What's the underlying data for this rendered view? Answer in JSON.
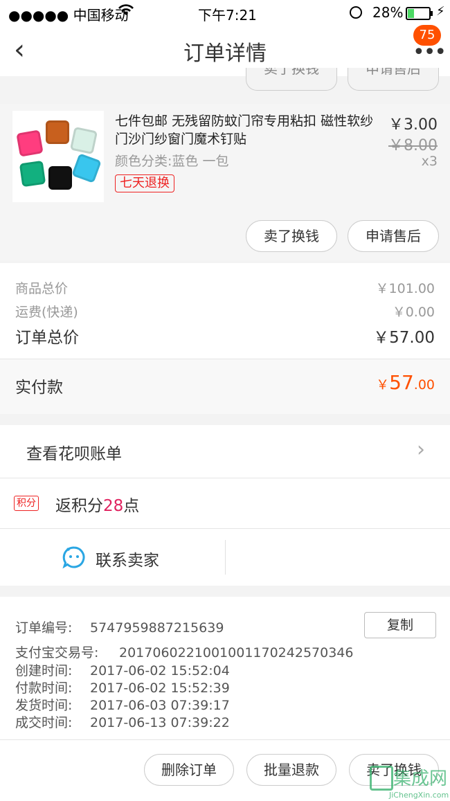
{
  "status_bar": {
    "carrier": "●●●●● 中国移动",
    "time": "下午7:21",
    "battery": "28%"
  },
  "nav": {
    "title": "订单详情",
    "badge": "75"
  },
  "partial_buttons": [
    "卖了换钱",
    "申请售后"
  ],
  "product": {
    "name": "七件包邮 无残留防蚊门帘专用粘扣 磁性软纱门沙门纱窗门魔术钉贴",
    "attributes": "颜色分类:蓝色 一包",
    "tag": "七天退换",
    "price": "￥3.00",
    "original_price": "￥8.00",
    "quantity": "x3",
    "buttons": [
      "卖了换钱",
      "申请售后"
    ],
    "cube_colors": [
      "#ff3d7f",
      "#c8601e",
      "#d9f0e6",
      "#12b07f",
      "#111111",
      "#39c6ee"
    ]
  },
  "summary": {
    "goods_total_label": "商品总价",
    "goods_total_value": "￥101.00",
    "shipping_label": "运费(快递)",
    "shipping_value": "￥0.00",
    "order_total_label": "订单总价",
    "order_total_value": "￥57.00",
    "paid_label": "实付款",
    "paid_currency": "￥",
    "paid_integer": "57",
    "paid_decimal": ".00"
  },
  "huabei": {
    "label": "查看花呗账单"
  },
  "points": {
    "badge": "积分",
    "prefix": "返积分",
    "count": "28",
    "suffix": "点"
  },
  "contact": {
    "label": "联系卖家"
  },
  "order_info": {
    "copy_button": "复制",
    "rows": [
      {
        "key": "订单编号:",
        "value": "5747959887215639"
      },
      {
        "key": "支付宝交易号:",
        "value": "2017060221001001170242570346"
      },
      {
        "key": "创建时间:",
        "value": "2017-06-02 15:52:04"
      },
      {
        "key": "付款时间:",
        "value": "2017-06-02 15:52:39"
      },
      {
        "key": "发货时间:",
        "value": "2017-06-03 07:39:17"
      },
      {
        "key": "成交时间:",
        "value": "2017-06-13 07:39:22"
      }
    ]
  },
  "bottom_buttons": [
    "删除订单",
    "批量退款",
    "卖了换钱"
  ],
  "watermark": {
    "text": "集成网",
    "url_text": "JiChengXin.com"
  },
  "colors": {
    "accent": "#ff5000",
    "points": "#e0225f",
    "tag_red": "#e22222"
  }
}
